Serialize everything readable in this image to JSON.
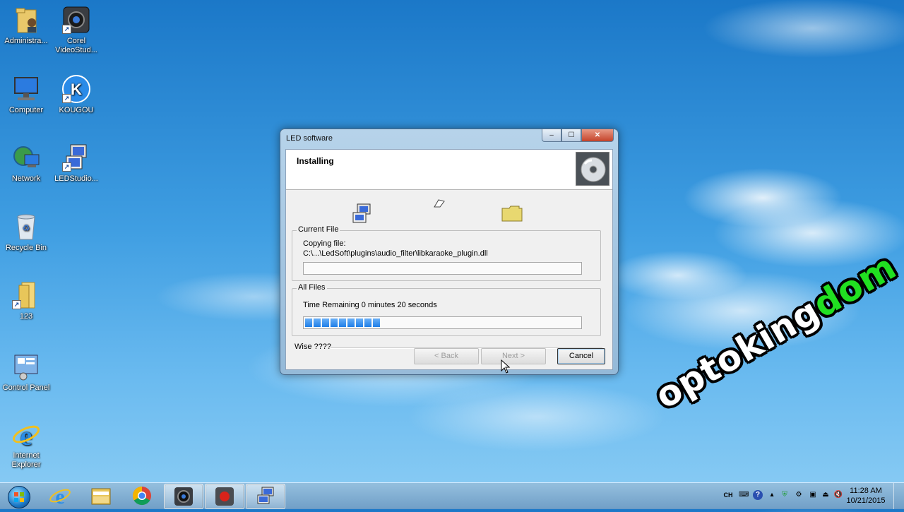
{
  "desktop": {
    "icons": [
      {
        "label": "Administra...",
        "icon": "user-folder-icon"
      },
      {
        "label": "Corel VideoStud...",
        "icon": "corel-videostudio-icon"
      },
      {
        "label": "Computer",
        "icon": "computer-icon"
      },
      {
        "label": "KOUGOU",
        "icon": "kougou-icon"
      },
      {
        "label": "Network",
        "icon": "network-icon"
      },
      {
        "label": "LEDStudio...",
        "icon": "ledstudio-icon"
      },
      {
        "label": "Recycle Bin",
        "icon": "recycle-bin-icon"
      },
      {
        "label": "123",
        "icon": "folder-icon"
      },
      {
        "label": "Control Panel",
        "icon": "control-panel-icon"
      },
      {
        "label": "Internet Explorer",
        "icon": "internet-explorer-icon"
      }
    ]
  },
  "window": {
    "title": "LED software",
    "controls": {
      "minimize": "–",
      "maximize": "☐",
      "close": "✕"
    },
    "header_title": "Installing",
    "current_file": {
      "group_label": "Current File",
      "action": "Copying file:",
      "path": "C:\\...\\LedSoft\\plugins\\audio_filter\\libkaraoke_plugin.dll",
      "progress": 0
    },
    "all_files": {
      "group_label": "All Files",
      "time_remaining": "Time Remaining 0 minutes 20 seconds",
      "progress": 0.29
    },
    "brand": "Wise ????",
    "buttons": {
      "back": "< Back",
      "next": "Next >",
      "cancel": "Cancel"
    }
  },
  "taskbar": {
    "pinned": [
      "internet-explorer-icon",
      "windows-explorer-icon",
      "chrome-icon",
      "corel-videostudio-icon",
      "recorder-icon",
      "ledstudio-installer-icon"
    ],
    "tray": {
      "language": "CH",
      "time": "11:28 AM",
      "date": "10/21/2015"
    }
  },
  "watermark": {
    "part1": "optoking",
    "part2": "dom"
  },
  "colors": {
    "progress": "#1e7fe8",
    "watermark_green": "#21e021"
  }
}
